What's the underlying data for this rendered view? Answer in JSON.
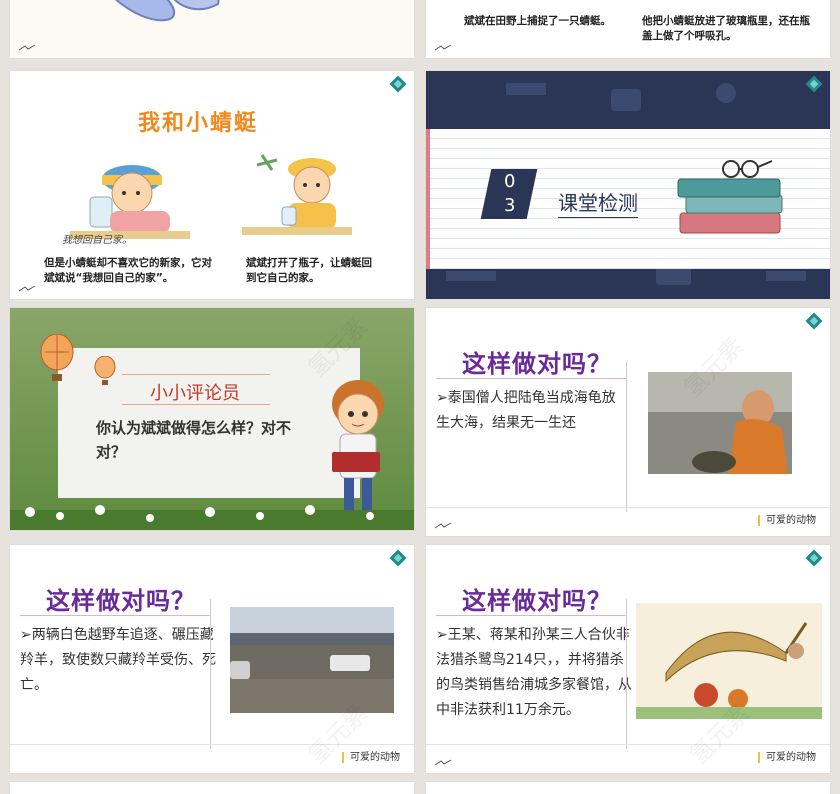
{
  "slide_top_right": {
    "caption_left": "斌斌在田野上捕捉了一只蜻蜓。",
    "caption_right": "他把小蜻蜓放进了玻璃瓶里，还在瓶盖上做了个呼吸孔。"
  },
  "slide_story": {
    "title": "我和小蜻蜓",
    "speech": "我想回自己家。",
    "caption_left": "但是小蜻蜓却不喜欢它的新家，它对斌斌说“我想回自己的家”。",
    "caption_right": "斌斌打开了瓶子，让蜻蜓回到它自己的家。"
  },
  "slide_section": {
    "number_top": "0",
    "number_bottom": "3",
    "label": "课堂检测"
  },
  "slide_reviewer": {
    "heading": "小小评论员",
    "question": "你认为斌斌做得怎么样？对不对？"
  },
  "slides_question": [
    {
      "title": "这样做对吗？",
      "text": "➢泰国僧人把陆龟当成海龟放生大海，结果无一生还",
      "footer": "可爱的动物"
    },
    {
      "title": "这样做对吗？",
      "text": "➢两辆白色越野车追逐、碾压藏羚羊，致使数只藏羚羊受伤、死亡。",
      "footer": "可爱的动物"
    },
    {
      "title": "这样做对吗？",
      "text": "➢王某、蒋某和孙某三人合伙非法猎杀鹭鸟214只，，并将猎杀的鸟类销售给浦城多家餐馆，从中非法获利11万余元。",
      "footer": "可爱的动物"
    }
  ],
  "watermark": "氢元素",
  "colors": {
    "question_title": "#6a2a9a",
    "story_title": "#f08a1e",
    "section_bg": "#2b3556",
    "footer_accent": "#e5c144"
  }
}
